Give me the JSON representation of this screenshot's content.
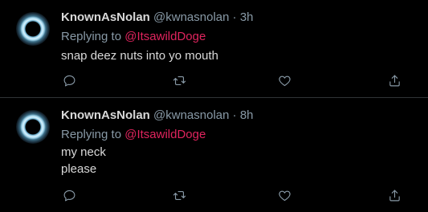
{
  "tweets": [
    {
      "display_name": "KnownAsNolan",
      "handle": "@kwnasnolan",
      "separator": "·",
      "time": "3h",
      "replying_to_label": "Replying to",
      "replying_to_handle": "@ItsawildDoge",
      "lines": [
        "snap deez nuts into yo mouth"
      ]
    },
    {
      "display_name": "KnownAsNolan",
      "handle": "@kwnasnolan",
      "separator": "·",
      "time": "8h",
      "replying_to_label": "Replying to",
      "replying_to_handle": "@ItsawildDoge",
      "lines": [
        "my neck",
        "please"
      ]
    }
  ],
  "actions": {
    "reply_icon": "reply-icon",
    "retweet_icon": "retweet-icon",
    "like_icon": "heart-icon",
    "share_icon": "share-icon"
  },
  "colors": {
    "background": "#000000",
    "text": "#d9d9d9",
    "secondary": "#8899a6",
    "mention": "#e0245e",
    "divider": "#2f3336"
  }
}
